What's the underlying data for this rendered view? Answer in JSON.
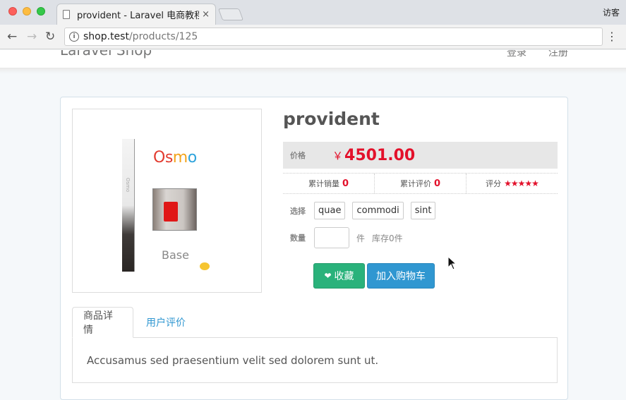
{
  "browser": {
    "tab_title": "provident - Laravel 电商教程",
    "tab_close": "×",
    "guest_label": "访客",
    "url_host": "shop.test",
    "url_path": "/products/125",
    "back_icon": "←",
    "forward_icon": "→",
    "reload_icon": "↻",
    "menu_icon": "⋮",
    "info_icon": "i"
  },
  "navbar": {
    "brand": "Laravel Shop",
    "login": "登录",
    "register": "注册"
  },
  "product": {
    "title": "provident",
    "image_brand": "Osmo",
    "image_caption": "Base",
    "price_label": "价格",
    "currency": "￥",
    "price": "4501.00",
    "sold_label": "累计销量",
    "sold_count": "0",
    "review_label": "累计评价",
    "review_count": "0",
    "rating_label": "评分",
    "rating_stars": "★★★★★",
    "sku_label": "选择",
    "skus": [
      "quae",
      "commodi",
      "sint"
    ],
    "qty_label": "数量",
    "qty_value": "",
    "qty_unit": "件",
    "stock_text": "库存0件",
    "favorite_icon": "❤",
    "favorite_label": "收藏",
    "cart_label": "加入购物车"
  },
  "tabs": {
    "detail": "商品详情",
    "reviews": "用户评价",
    "description": "Accusamus sed praesentium velit sed dolorem sunt ut."
  },
  "colors": {
    "price_red": "#e3112b",
    "favorite_green": "#2ab27b",
    "cart_blue": "#3097d1"
  }
}
